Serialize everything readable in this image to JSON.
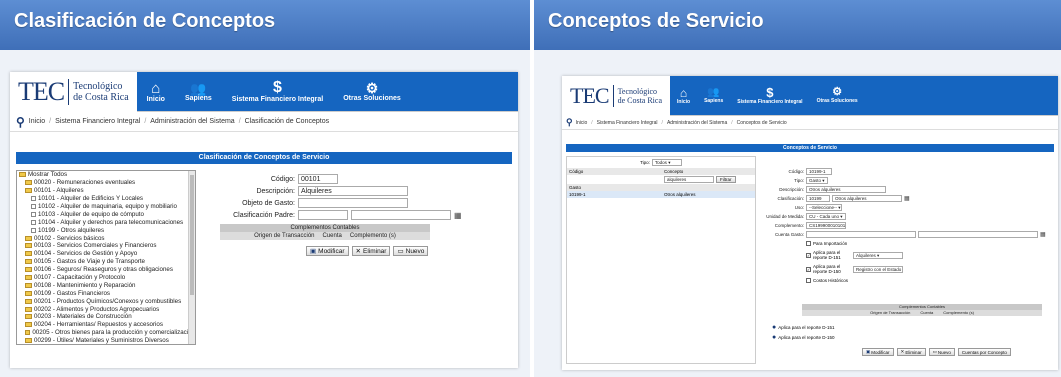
{
  "left": {
    "slide_title": "Clasificación de Conceptos",
    "logo": {
      "tec": "TEC",
      "name1": "Tecnológico",
      "name2": "de Costa Rica"
    },
    "nav": [
      {
        "icon": "home-icon",
        "label": "Inicio"
      },
      {
        "icon": "users-icon",
        "label": "Sapiens"
      },
      {
        "icon": "dollar-icon",
        "label": "Sistema Financiero Integral"
      },
      {
        "icon": "gears-icon",
        "label": "Otras Soluciones"
      }
    ],
    "breadcrumb": [
      "Inicio",
      "Sistema Financiero Integral",
      "Administración del Sistema",
      "Clasificación de Conceptos"
    ],
    "section_title": "Clasificación de Conceptos de Servicio",
    "tree": [
      {
        "t": "Mostrar Todos",
        "lvl": 0,
        "kind": "folder"
      },
      {
        "t": "00020 - Remuneraciones eventuales",
        "lvl": 1,
        "kind": "folder"
      },
      {
        "t": "00101 - Alquileres",
        "lvl": 1,
        "kind": "folder"
      },
      {
        "t": "10101 - Alquiler de Edificios Y Locales",
        "lvl": 2,
        "kind": "doc"
      },
      {
        "t": "10102 - Alquiler de maquinaria, equipo y mobiliario",
        "lvl": 2,
        "kind": "doc"
      },
      {
        "t": "10103 - Alquiler de equipo de cómputo",
        "lvl": 2,
        "kind": "doc"
      },
      {
        "t": "10104 - Alquiler y derechos para telecomunicaciones",
        "lvl": 2,
        "kind": "doc"
      },
      {
        "t": "10199 - Otros alquileres",
        "lvl": 2,
        "kind": "doc"
      },
      {
        "t": "00102 - Servicios básicos",
        "lvl": 1,
        "kind": "folder"
      },
      {
        "t": "00103 - Servicios Comerciales y Financieros",
        "lvl": 1,
        "kind": "folder"
      },
      {
        "t": "00104 - Servicios de Gestión y Apoyo",
        "lvl": 1,
        "kind": "folder"
      },
      {
        "t": "00105 - Gastos de Viaje y de Transporte",
        "lvl": 1,
        "kind": "folder"
      },
      {
        "t": "00106 - Seguros/ Reaseguros y otras obligaciones",
        "lvl": 1,
        "kind": "folder"
      },
      {
        "t": "00107 - Capacitación y Protocolo",
        "lvl": 1,
        "kind": "folder"
      },
      {
        "t": "00108 - Mantenimiento y Reparación",
        "lvl": 1,
        "kind": "folder"
      },
      {
        "t": "00109 - Gastos Financieros",
        "lvl": 1,
        "kind": "folder"
      },
      {
        "t": "00201 - Productos Químicos/Conexos y combustibles",
        "lvl": 1,
        "kind": "folder"
      },
      {
        "t": "00202 - Alimentos y Productos Agropecuarios",
        "lvl": 1,
        "kind": "folder"
      },
      {
        "t": "00203 - Materiales de Construcción",
        "lvl": 1,
        "kind": "folder"
      },
      {
        "t": "00204 - Herramientas/ Repuestos y accesorios",
        "lvl": 1,
        "kind": "folder"
      },
      {
        "t": "00205 - Otros bienes para la producción y comercialización",
        "lvl": 1,
        "kind": "folder"
      },
      {
        "t": "00299 - Útiles/ Materiales y Suministros Diversos",
        "lvl": 1,
        "kind": "folder"
      }
    ],
    "form": {
      "codigo_label": "Código:",
      "codigo": "00101",
      "descripcion_label": "Descripción:",
      "descripcion": "Alquileres",
      "objeto_label": "Objeto de Gasto:",
      "objeto": "",
      "padre_label": "Clasificación Padre:",
      "padre": ""
    },
    "complementos_title": "Complementos Contables",
    "complementos_cols": [
      "Origen de Transacción",
      "Cuenta",
      "Complemento (s)"
    ],
    "buttons": [
      "Modificar",
      "Eliminar",
      "Nuevo"
    ]
  },
  "right": {
    "slide_title": "Conceptos de Servicio",
    "logo": {
      "tec": "TEC",
      "name1": "Tecnológico",
      "name2": "de Costa Rica"
    },
    "nav": [
      {
        "icon": "home-icon",
        "label": "Inicio"
      },
      {
        "icon": "users-icon",
        "label": "Sapiens"
      },
      {
        "icon": "dollar-icon",
        "label": "Sistema Financiero Integral"
      },
      {
        "icon": "gears-icon",
        "label": "Otras Soluciones"
      }
    ],
    "breadcrumb": [
      "Inicio",
      "Sistema Financiero Integral",
      "Administración del Sistema",
      "Conceptos de Servicio"
    ],
    "section_title": "Conceptos de Servicio",
    "filter": {
      "tipo_label": "Tipo:",
      "tipo": "Todos",
      "concepto_value": "alquileres",
      "filtrar": "Filtrar"
    },
    "list_cols": [
      "Código",
      "Concepto"
    ],
    "list_group": "Gasto",
    "list_rows": [
      {
        "codigo": "10199-1",
        "concepto": "Otros alquileres"
      }
    ],
    "form": {
      "codigo_label": "Código:",
      "codigo": "10199-1",
      "tipo_label": "Tipo:",
      "tipo": "Gasto",
      "descripcion_label": "Descripción:",
      "descripcion": "Otros alquileres",
      "clasificacion_label": "Clasificación:",
      "clasificacion_code": "10199",
      "clasificacion": "Otros alquileres",
      "uso_label": "Uso:",
      "uso": "--Seleccione--",
      "unidad_label": "Unidad de Medida:",
      "unidad": "CU - Cada uno",
      "complemento_label": "Complemento:",
      "complemento": "CS1999000101010",
      "cuenta_label": "Cuenta Gasto:",
      "cuenta": ""
    },
    "checks": [
      {
        "label": "Para Importación",
        "checked": false
      },
      {
        "label": "Aplica para el reporte D-151",
        "checked": true,
        "select": "Alquileres"
      },
      {
        "label": "Aplica para el reporte D-150",
        "checked": true,
        "select": "Registro con el Estado"
      },
      {
        "label": "Costos Históricos",
        "checked": false
      }
    ],
    "complementos_title": "Complementos Contables",
    "complementos_cols": [
      "Origen de Transacción",
      "Cuenta",
      "Complemento (s)"
    ],
    "notes": [
      "Aplica para el reporte D-151",
      "Aplica para el reporte D-150"
    ],
    "buttons": [
      "Modificar",
      "Eliminar",
      "Nuevo",
      "Cuentas por Concepto"
    ]
  }
}
